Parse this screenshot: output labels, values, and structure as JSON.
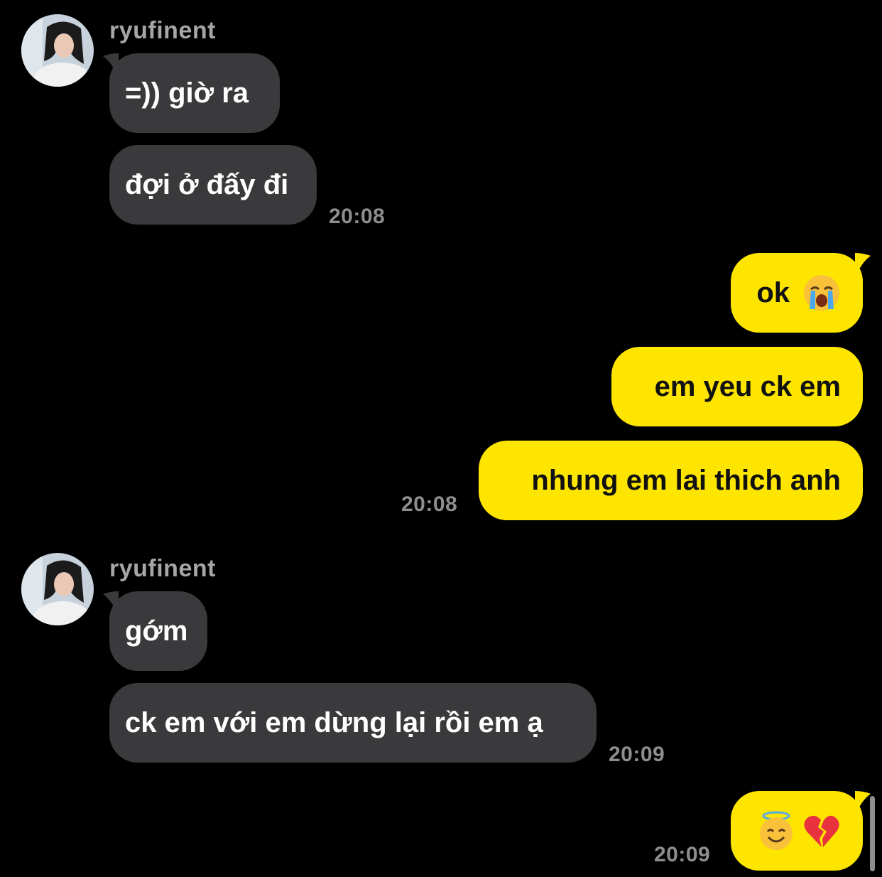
{
  "colors": {
    "background": "#000000",
    "incoming_bubble": "#3a3a3c",
    "outgoing_bubble": "#fee500",
    "timestamp": "#8e8e8e",
    "sender": "#a6a6a6"
  },
  "groups": [
    {
      "sender": "ryufinent",
      "messages": [
        "=)) giờ ra",
        "đợi ở đấy đi"
      ],
      "time": "20:08"
    },
    {
      "messages": [
        "ok",
        "em yeu ck em",
        "nhung em lai thich anh"
      ],
      "emoji_after_first": "loudly-crying-face-emoji",
      "time": "20:08"
    },
    {
      "sender": "ryufinent",
      "messages": [
        "gớm",
        "ck em với em dừng lại rồi em ạ"
      ],
      "time": "20:09"
    },
    {
      "emojis": [
        "smiling-face-with-halo-emoji",
        "broken-heart-emoji"
      ],
      "time": "20:09"
    }
  ]
}
